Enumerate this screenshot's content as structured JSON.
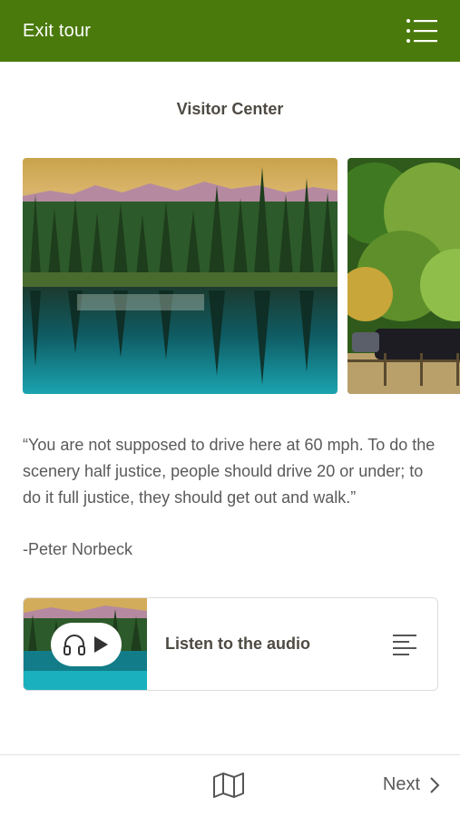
{
  "header": {
    "exit_label": "Exit tour",
    "menu_icon": "list-menu-icon",
    "background_color": "#4a7a0c"
  },
  "stop": {
    "title": "Visitor Center"
  },
  "gallery": {
    "images": [
      {
        "name": "lake-reflection-photo"
      },
      {
        "name": "parking-trees-photo"
      }
    ]
  },
  "quote": {
    "text": "“You are not supposed to drive here at 60 mph. To do the scenery half justice, people should drive 20 or under; to do it full justice, they should get out and walk.”",
    "attribution": "-Peter Norbeck"
  },
  "audio": {
    "label": "Listen to the audio",
    "play_icon": "headphones-play-icon",
    "transcript_icon": "transcript-lines-icon"
  },
  "footer": {
    "map_icon": "map-icon",
    "next_label": "Next",
    "next_icon": "chevron-right-icon"
  }
}
